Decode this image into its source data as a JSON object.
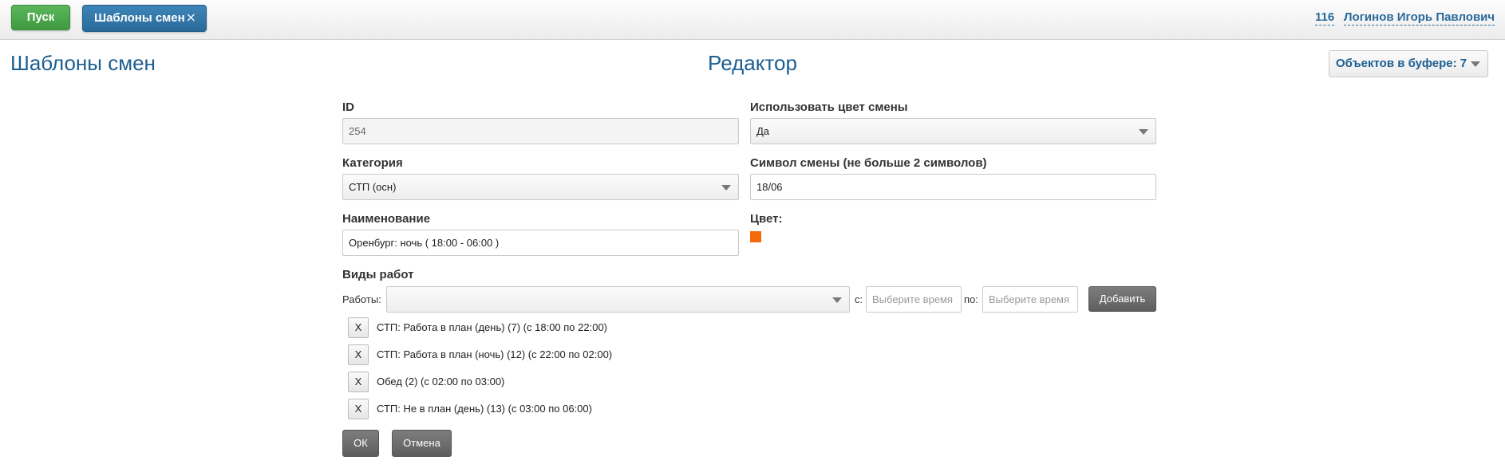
{
  "topbar": {
    "start_label": "Пуск",
    "active_tab": {
      "label": "Шаблоны смен",
      "close_label": "⨯"
    },
    "user_id": "116",
    "user_name": "Логинов Игорь Павлович"
  },
  "page": {
    "title": "Шаблоны смен",
    "editor_title": "Редактор",
    "buffer_label": "Объектов в буфере: 7"
  },
  "form": {
    "id": {
      "label": "ID",
      "value": "254"
    },
    "use_color": {
      "label": "Использовать цвет смены",
      "value": "Да"
    },
    "category": {
      "label": "Категория",
      "value": "СТП (осн)"
    },
    "symbol": {
      "label": "Символ смены (не больше 2 символов)",
      "value": "18/06"
    },
    "name": {
      "label": "Наименование",
      "value": "Оренбург: ночь ( 18:00 - 06:00 )"
    },
    "color": {
      "label": "Цвет:",
      "hex": "#f56a0a"
    }
  },
  "work_types": {
    "title": "Виды работ",
    "jobs_label": "Работы:",
    "jobs_value": "",
    "from_label": "с:",
    "from_placeholder": "Выберите время",
    "to_label": "по:",
    "to_placeholder": "Выберите время",
    "add_label": "Добавить",
    "items": [
      {
        "remove": "X",
        "text": "СТП: Работа в план (день) (7) (с 18:00 по 22:00)"
      },
      {
        "remove": "X",
        "text": "СТП: Работа в план (ночь) (12) (с 22:00 по 02:00)"
      },
      {
        "remove": "X",
        "text": "Обед (2) (с 02:00 по 03:00)"
      },
      {
        "remove": "X",
        "text": "СТП: Не в план (день) (13) (с 03:00 по 06:00)"
      }
    ]
  },
  "actions": {
    "ok_label": "ОК",
    "cancel_label": "Отмена"
  },
  "colors": {
    "accent": "#1c5f91",
    "start_green": "#4ca84c",
    "tab_blue": "#2f77aa"
  }
}
